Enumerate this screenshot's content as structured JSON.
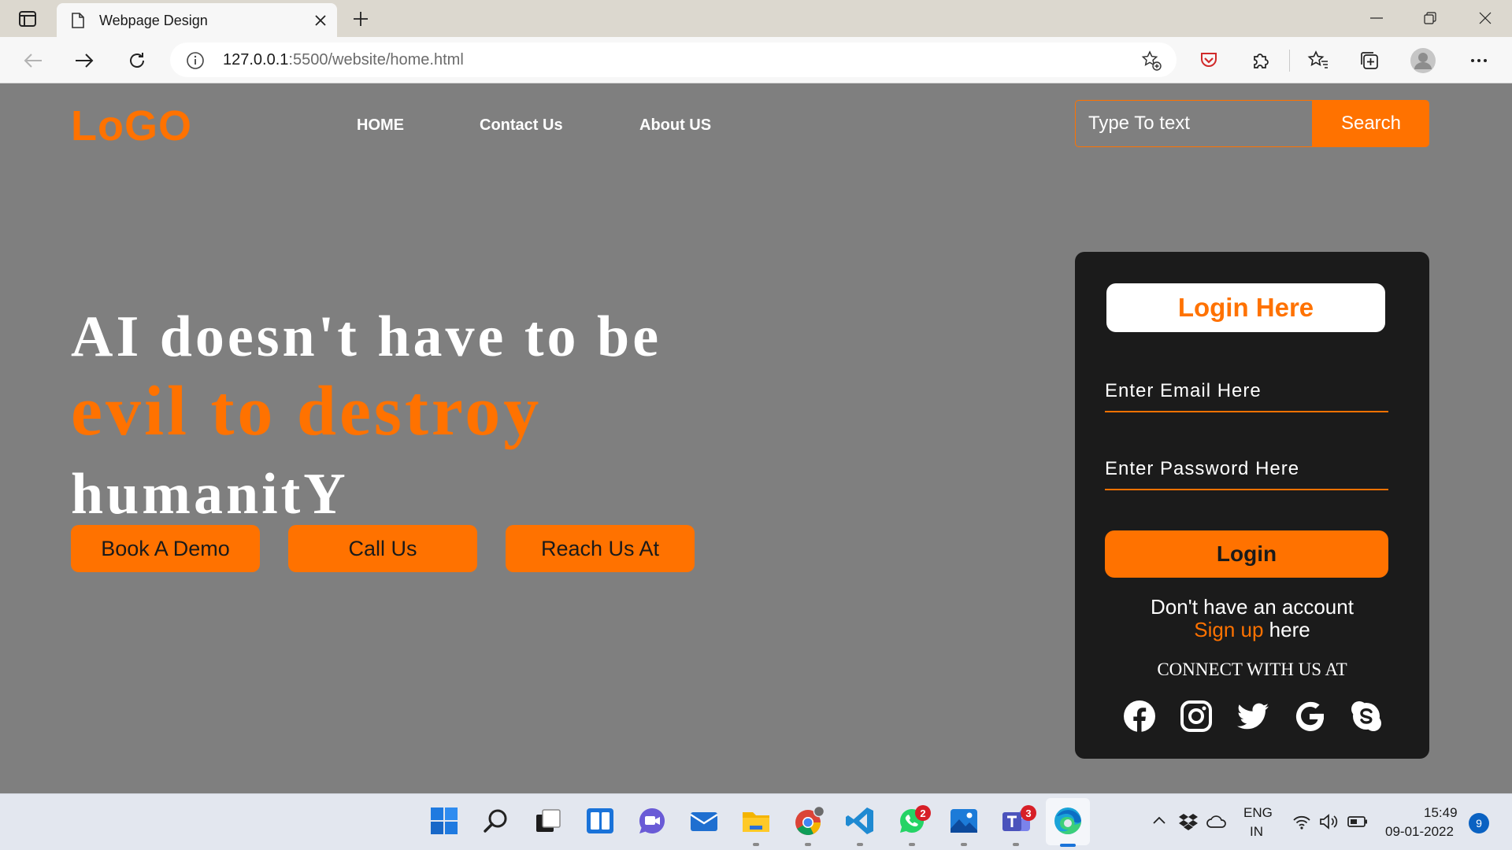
{
  "browser": {
    "tab_title": "Webpage Design",
    "url_host": "127.0.0.1",
    "url_path": ":5500/website/home.html"
  },
  "site": {
    "logo": "LoGO",
    "nav": [
      {
        "label": "HOME"
      },
      {
        "label": "Contact Us"
      },
      {
        "label": "About US"
      }
    ],
    "search": {
      "placeholder": "Type To text",
      "button": "Search"
    },
    "hero": {
      "line1": "AI doesn't have to be",
      "line2": "evil to destroy",
      "line3": "humanitY"
    },
    "cta": [
      {
        "label": "Book A Demo"
      },
      {
        "label": "Call Us"
      },
      {
        "label": "Reach Us At"
      }
    ],
    "login": {
      "title": "Login Here",
      "email_placeholder": "Enter Email Here",
      "password_placeholder": "Enter Password Here",
      "button": "Login",
      "no_account": "Don't have an account",
      "signup_link": "Sign up",
      "signup_suffix": " here",
      "connect": "CONNECT WITH US AT",
      "social": [
        "facebook-icon",
        "instagram-icon",
        "twitter-icon",
        "google-icon",
        "skype-icon"
      ]
    }
  },
  "colors": {
    "accent": "#ff7200",
    "page_bg": "#7f7f7f",
    "card_bg": "#1b1b1b"
  },
  "taskbar": {
    "badges": {
      "whatsapp": "2",
      "teams": "3"
    },
    "lang": "ENG",
    "region": "IN",
    "time": "15:49",
    "date": "09-01-2022",
    "notifications": "9"
  }
}
